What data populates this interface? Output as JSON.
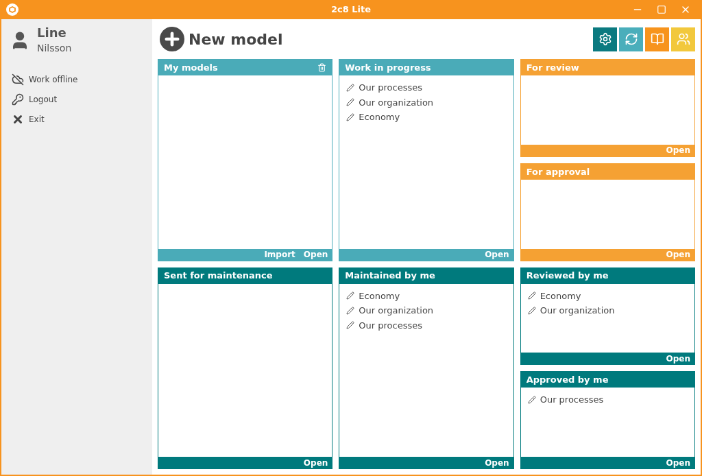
{
  "window": {
    "title": "2c8 Lite"
  },
  "user": {
    "first_name": "Line",
    "last_name": "Nilsson"
  },
  "sidebar": {
    "items": [
      {
        "kind": "offline",
        "label": "Work offline"
      },
      {
        "kind": "logout",
        "label": "Logout"
      },
      {
        "kind": "exit",
        "label": "Exit"
      }
    ]
  },
  "new_model": {
    "label": "New model"
  },
  "toolbar": [
    {
      "kind": "settings"
    },
    {
      "kind": "sync"
    },
    {
      "kind": "book"
    },
    {
      "kind": "users"
    }
  ],
  "columns": [
    {
      "panels": [
        {
          "title": "My models",
          "color": "#4aabb8",
          "delete": true,
          "actions": [
            "Import",
            "Open"
          ]
        },
        {
          "title": "Sent for maintenance",
          "color": "#007a7d",
          "delete": false,
          "actions": [
            "Open"
          ]
        }
      ]
    },
    {
      "panels": [
        {
          "title": "Work in progress",
          "color": "#4aabb8",
          "delete": false,
          "items": [
            "Our processes",
            "Our organization",
            "Economy"
          ],
          "actions": [
            "Open"
          ]
        },
        {
          "title": "Maintained by me",
          "color": "#007a7d",
          "delete": false,
          "items": [
            "Economy",
            "Our organization",
            "Our processes"
          ],
          "actions": [
            "Open"
          ]
        }
      ]
    },
    {
      "panels": [
        {
          "title": "For review",
          "color": "#f5a133",
          "delete": false,
          "actions": [
            "Open"
          ]
        },
        {
          "title": "For approval",
          "color": "#f5a133",
          "delete": false,
          "actions": [
            "Open"
          ]
        },
        {
          "title": "Reviewed by me",
          "color": "#007a7d",
          "delete": false,
          "items": [
            "Economy",
            "Our organization"
          ],
          "actions": [
            "Open"
          ]
        },
        {
          "title": "Approved by me",
          "color": "#007a7d",
          "delete": false,
          "items": [
            "Our processes"
          ],
          "actions": [
            "Open"
          ]
        }
      ]
    }
  ]
}
